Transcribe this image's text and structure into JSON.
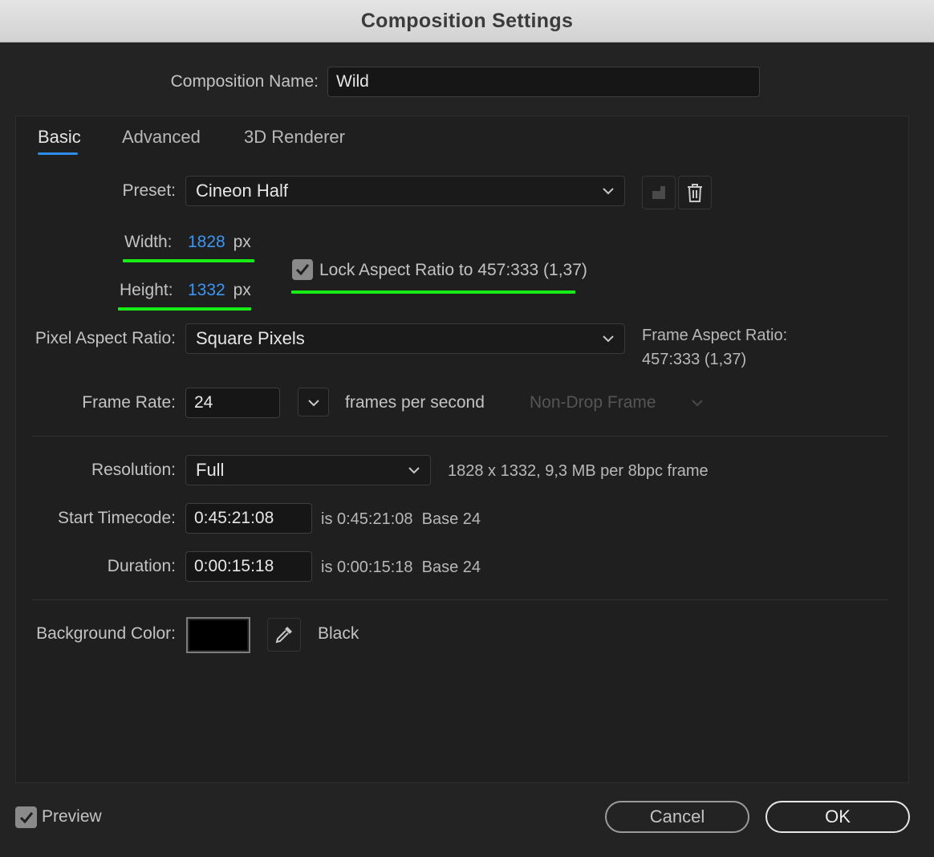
{
  "window": {
    "title": "Composition Settings"
  },
  "composition": {
    "name_label": "Composition Name:",
    "name_value": "Wild"
  },
  "tabs": [
    {
      "label": "Basic",
      "active": true
    },
    {
      "label": "Advanced",
      "active": false
    },
    {
      "label": "3D Renderer",
      "active": false
    }
  ],
  "preset": {
    "label": "Preset:",
    "value": "Cineon Half"
  },
  "width": {
    "label": "Width:",
    "value": "1828",
    "unit": "px"
  },
  "height": {
    "label": "Height:",
    "value": "1332",
    "unit": "px"
  },
  "lock_aspect": {
    "label": "Lock Aspect Ratio to 457:333 (1,37)",
    "checked": true
  },
  "pixel_aspect": {
    "label": "Pixel Aspect Ratio:",
    "value": "Square Pixels"
  },
  "frame_aspect": {
    "label": "Frame Aspect Ratio:",
    "value": "457:333 (1,37)"
  },
  "frame_rate": {
    "label": "Frame Rate:",
    "value": "24",
    "unit_label": "frames per second",
    "drop_frame": "Non-Drop Frame"
  },
  "resolution": {
    "label": "Resolution:",
    "value": "Full",
    "info": "1828 x 1332, 9,3 MB per 8bpc frame"
  },
  "start_timecode": {
    "label": "Start Timecode:",
    "value": "0:45:21:08",
    "info": "is 0:45:21:08  Base 24"
  },
  "duration": {
    "label": "Duration:",
    "value": "0:00:15:18",
    "info": "is 0:00:15:18  Base 24"
  },
  "background": {
    "label": "Background Color:",
    "color_name": "Black",
    "color": "#000000"
  },
  "footer": {
    "preview_label": "Preview",
    "preview_checked": true,
    "cancel_label": "Cancel",
    "ok_label": "OK"
  },
  "colors": {
    "accent": "#2d8ceb",
    "highlight": "#17ec17",
    "link_blue": "#3d95f2"
  }
}
